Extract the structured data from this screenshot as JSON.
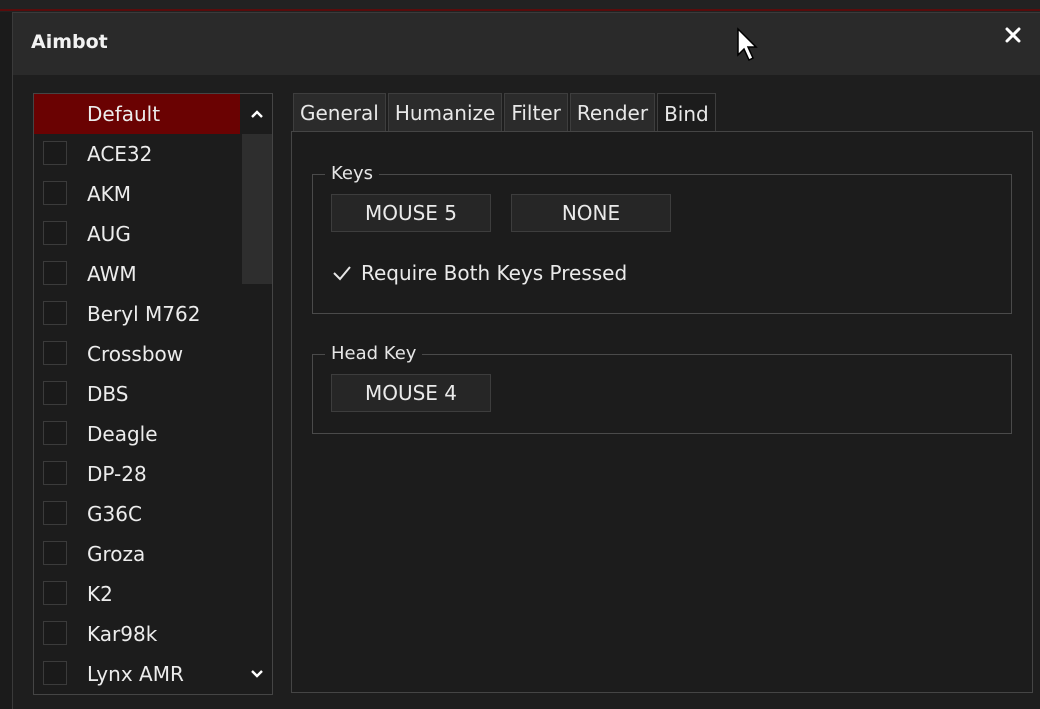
{
  "window": {
    "title": "Aimbot",
    "close_label": "×"
  },
  "colors": {
    "accent_red": "#6a0202",
    "background": "#1c1c1c",
    "titlebar": "#2a2a2a"
  },
  "weapon_list": {
    "items": [
      {
        "label": "Default",
        "selected": true,
        "checked": false
      },
      {
        "label": "ACE32",
        "selected": false,
        "checked": false
      },
      {
        "label": "AKM",
        "selected": false,
        "checked": false
      },
      {
        "label": "AUG",
        "selected": false,
        "checked": false
      },
      {
        "label": "AWM",
        "selected": false,
        "checked": false
      },
      {
        "label": "Beryl M762",
        "selected": false,
        "checked": false
      },
      {
        "label": "Crossbow",
        "selected": false,
        "checked": false
      },
      {
        "label": "DBS",
        "selected": false,
        "checked": false
      },
      {
        "label": "Deagle",
        "selected": false,
        "checked": false
      },
      {
        "label": "DP-28",
        "selected": false,
        "checked": false
      },
      {
        "label": "G36C",
        "selected": false,
        "checked": false
      },
      {
        "label": "Groza",
        "selected": false,
        "checked": false
      },
      {
        "label": "K2",
        "selected": false,
        "checked": false
      },
      {
        "label": "Kar98k",
        "selected": false,
        "checked": false
      },
      {
        "label": "Lynx AMR",
        "selected": false,
        "checked": false
      }
    ],
    "scroll_up_icon": "chevron-up-icon",
    "scroll_down_icon": "chevron-down-icon"
  },
  "tabs": [
    {
      "label": "General",
      "active": false
    },
    {
      "label": "Humanize",
      "active": false
    },
    {
      "label": "Filter",
      "active": false
    },
    {
      "label": "Render",
      "active": false
    },
    {
      "label": "Bind",
      "active": true
    }
  ],
  "bind": {
    "keys_group": {
      "title": "Keys",
      "key1": "MOUSE 5",
      "key2": "NONE",
      "require_both_label": "Require Both Keys Pressed",
      "require_both_checked": true
    },
    "head_key_group": {
      "title": "Head Key",
      "key": "MOUSE 4"
    }
  }
}
